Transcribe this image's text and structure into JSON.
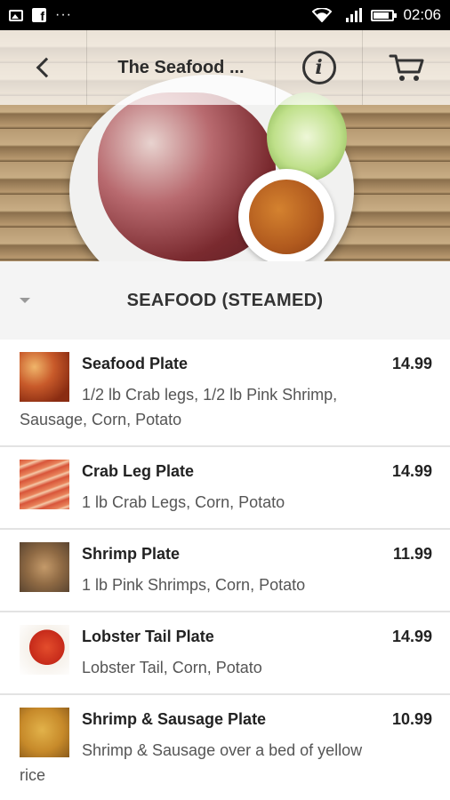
{
  "status_bar": {
    "time": "02:06",
    "left_icons": [
      "image-icon",
      "facebook-icon",
      "more-dots-icon"
    ],
    "right_icons": [
      "wifi-icon",
      "signal-icon",
      "battery-icon"
    ],
    "battery_level": 0.85
  },
  "app_bar": {
    "title": "The Seafood ...",
    "back_icon": "chevron-left-icon",
    "info_icon": "info-icon",
    "cart_icon": "cart-icon"
  },
  "section": {
    "title": "SEAFOOD (STEAMED)",
    "collapse_icon": "caret-down-icon"
  },
  "menu_items": [
    {
      "name": "Seafood Plate",
      "price": "14.99",
      "description": "1/2 lb Crab legs, 1/2 lb Pink Shrimp, Sausage, Corn, Potato"
    },
    {
      "name": "Crab Leg Plate",
      "price": "14.99",
      "description": "1 lb Crab Legs, Corn, Potato"
    },
    {
      "name": "Shrimp Plate",
      "price": "11.99",
      "description": "1 lb Pink Shrimps, Corn, Potato"
    },
    {
      "name": "Lobster Tail Plate",
      "price": "14.99",
      "description": "Lobster Tail, Corn, Potato"
    },
    {
      "name": "Shrimp & Sausage Plate",
      "price": "10.99",
      "description": "Shrimp & Sausage over a bed of yellow rice"
    }
  ],
  "colors": {
    "status_bar_bg": "#000000",
    "section_bg": "#f4f4f4",
    "divider": "#e3e3e3",
    "text_primary": "#222222",
    "text_secondary": "#555555"
  }
}
